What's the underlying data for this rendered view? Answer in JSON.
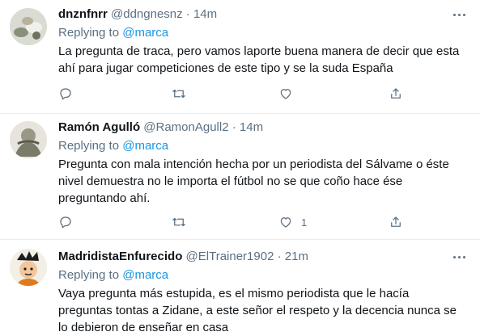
{
  "tweets": [
    {
      "name": "dnznfnrr",
      "handle": "@ddngnesnz",
      "dot": "·",
      "time": "14m",
      "replying_prefix": "Replying to",
      "replying_to": "@marca",
      "text": "La pregunta de traca, pero vamos laporte buena manera de decir que esta ahí para jugar competiciones de este tipo y se la suda España",
      "like_count": ""
    },
    {
      "name": "Ramón Agulló",
      "handle": "@RamonAgull2",
      "dot": "·",
      "time": "14m",
      "replying_prefix": "Replying to",
      "replying_to": "@marca",
      "text": "Pregunta con mala intención hecha por un periodista del Sálvame o éste nivel demuestra no le importa el fútbol no se que coño hace ése preguntando ahí.",
      "like_count": "1"
    },
    {
      "name": "MadridistaEnfurecido",
      "handle": "@ElTrainer1902",
      "dot": "·",
      "time": "21m",
      "replying_prefix": "Replying to",
      "replying_to": "@marca",
      "text": "Vaya pregunta más estupida, es el mismo periodista que le hacía preguntas tontas a Zidane, a este señor el respeto y la decencia nunca se lo debieron de enseñar en casa",
      "like_count": ""
    }
  ],
  "icons": [
    "more-icon",
    "reply-icon",
    "retweet-icon",
    "like-icon",
    "share-icon"
  ],
  "colors": {
    "link": "#1b95e0",
    "muted": "#5b7083",
    "text": "#0f1419",
    "divider": "#e6ecf0"
  }
}
